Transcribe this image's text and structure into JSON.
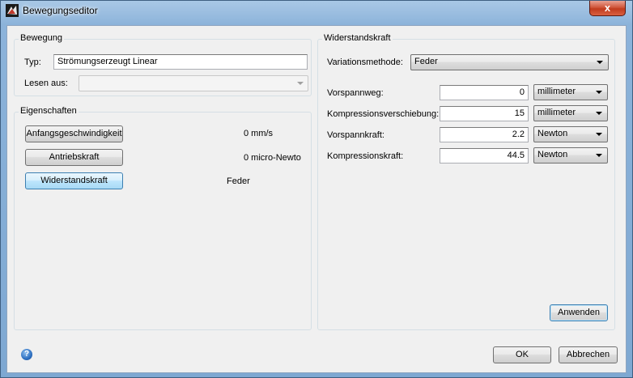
{
  "window": {
    "title": "Bewegungseditor",
    "close_label": "x"
  },
  "bewegung": {
    "title": "Bewegung",
    "typ_label": "Typ:",
    "typ_value": "Strömungserzeugt Linear",
    "lesen_label": "Lesen aus:",
    "lesen_value": ""
  },
  "eigenschaften": {
    "title": "Eigenschaften",
    "rows": [
      {
        "button": "Anfangsgeschwindigkeit",
        "value": "0  mm/s"
      },
      {
        "button": "Antriebskraft",
        "value": "0  micro-Newto"
      },
      {
        "button": "Widerstandskraft",
        "value": "Feder"
      }
    ]
  },
  "widerstandskraft": {
    "title": "Widerstandskraft",
    "methode_label": "Variationsmethode:",
    "methode_value": "Feder",
    "fields": [
      {
        "label": "Vorspannweg:",
        "value": "0",
        "unit": "millimeter"
      },
      {
        "label": "Kompressionsverschiebung:",
        "value": "15",
        "unit": "millimeter"
      },
      {
        "label": "Vorspannkraft:",
        "value": "2.2",
        "unit": "Newton"
      },
      {
        "label": "Kompressionskraft:",
        "value": "44.5",
        "unit": "Newton"
      }
    ],
    "apply_label": "Anwenden"
  },
  "footer": {
    "help_label": "?",
    "ok_label": "OK",
    "cancel_label": "Abbrechen"
  },
  "colors": {
    "selected_button": "#bee6fd",
    "close_button": "#c13b1e"
  }
}
